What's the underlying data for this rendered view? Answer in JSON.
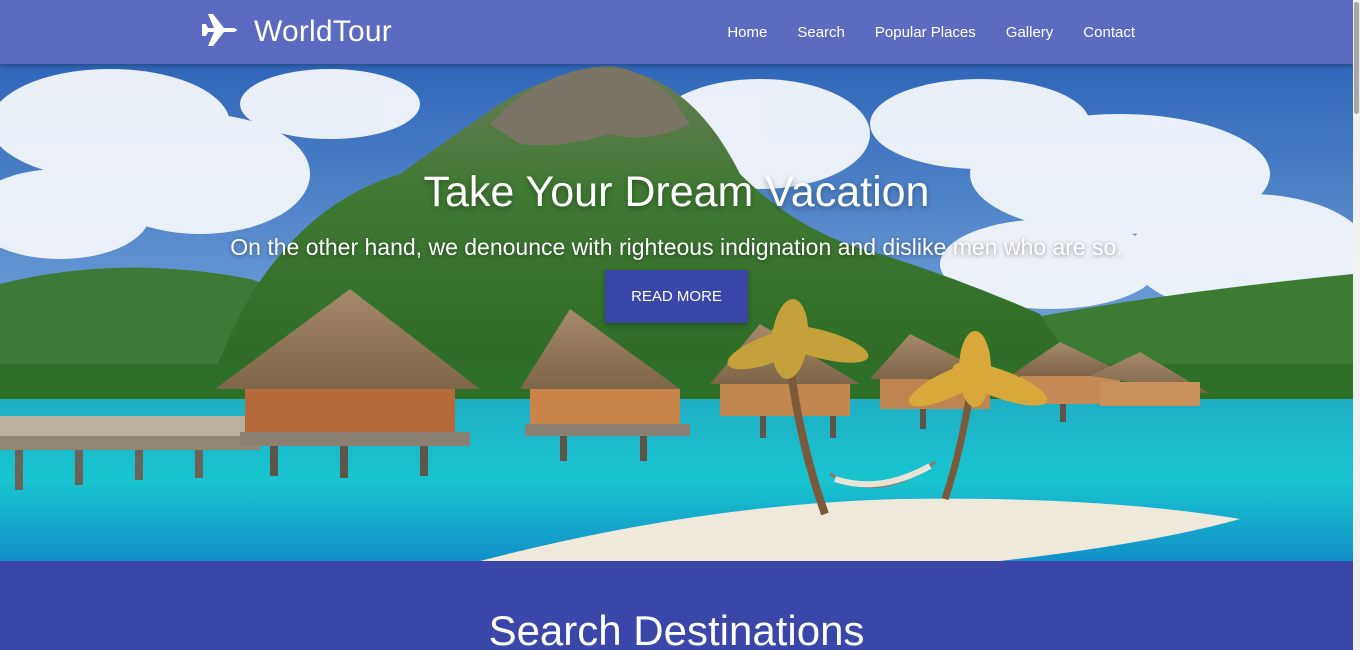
{
  "brand": {
    "name": "WorldTour",
    "icon": "airplane-icon"
  },
  "nav": {
    "items": [
      {
        "label": "Home"
      },
      {
        "label": "Search"
      },
      {
        "label": "Popular Places"
      },
      {
        "label": "Gallery"
      },
      {
        "label": "Contact"
      }
    ]
  },
  "hero": {
    "title": "Take Your Dream Vacation",
    "subtitle": "On the other hand, we denounce with righteous indignation and dislike men who are so.",
    "button_label": "READ MORE"
  },
  "search_section": {
    "title": "Search Destinations"
  },
  "colors": {
    "navbar": "#5c6bc0",
    "primary": "#3a47a8",
    "text": "#ffffff"
  }
}
